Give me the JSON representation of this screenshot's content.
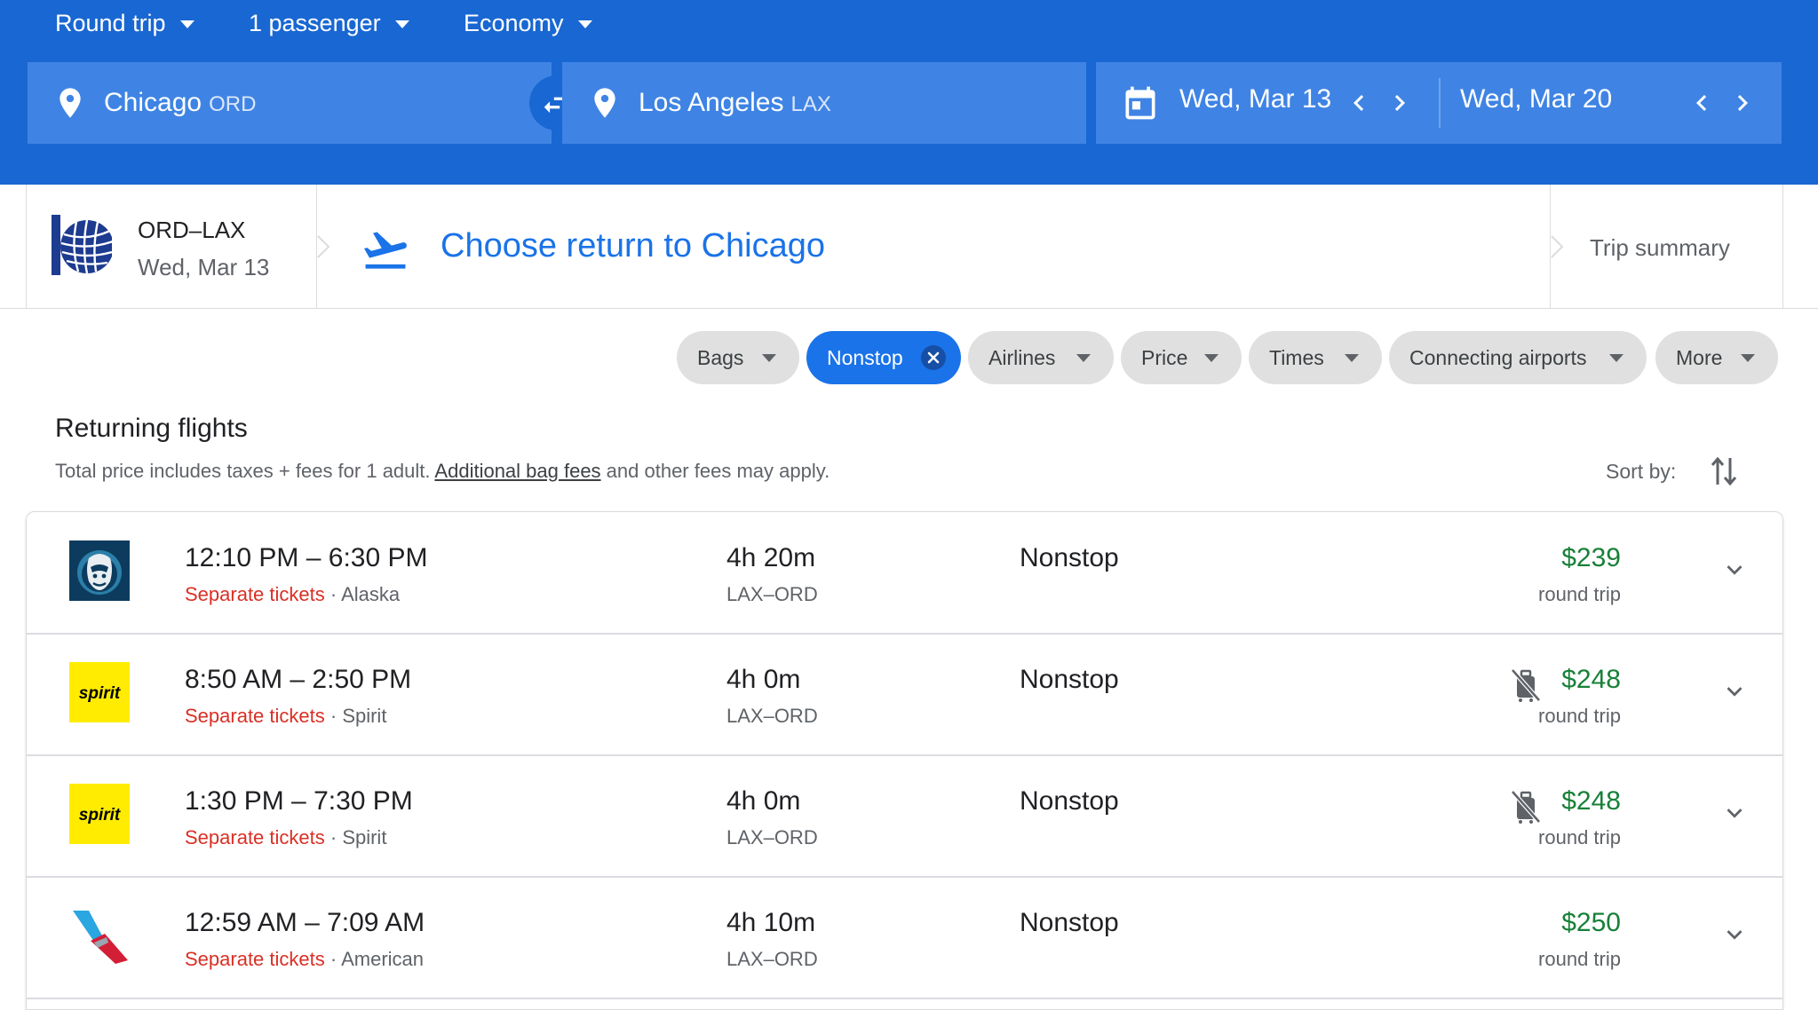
{
  "search": {
    "trip_type": "Round trip",
    "passengers": "1 passenger",
    "cabin": "Economy",
    "origin_city": "Chicago",
    "origin_code": "ORD",
    "destination_city": "Los Angeles",
    "destination_code": "LAX",
    "depart_date": "Wed, Mar 13",
    "return_date": "Wed, Mar 20"
  },
  "breadcrumb": {
    "leg_route": "ORD–LAX",
    "leg_date": "Wed, Mar 13",
    "step_title": "Choose return to Chicago",
    "trip_summary": "Trip summary"
  },
  "filters": [
    {
      "label": "Bags",
      "active": false
    },
    {
      "label": "Nonstop",
      "active": true
    },
    {
      "label": "Airlines",
      "active": false
    },
    {
      "label": "Price",
      "active": false
    },
    {
      "label": "Times",
      "active": false
    },
    {
      "label": "Connecting airports",
      "active": false
    },
    {
      "label": "More",
      "active": false
    }
  ],
  "results_header": {
    "title": "Returning flights",
    "note_prefix": "Total price includes taxes + fees for 1 adult. ",
    "note_link": "Additional bag fees",
    "note_suffix": " and other fees may apply.",
    "sort_label": "Sort by:"
  },
  "flights": [
    {
      "times": "12:10 PM – 6:30 PM",
      "tickets": "Separate tickets",
      "airline": "Alaska",
      "duration": "4h 20m",
      "route": "LAX–ORD",
      "stops": "Nonstop",
      "price": "$239",
      "price_type": "round trip",
      "logo": "alaska-logo",
      "no_carry_on": false
    },
    {
      "times": "8:50 AM – 2:50 PM",
      "tickets": "Separate tickets",
      "airline": "Spirit",
      "duration": "4h 0m",
      "route": "LAX–ORD",
      "stops": "Nonstop",
      "price": "$248",
      "price_type": "round trip",
      "logo": "spirit-logo",
      "no_carry_on": true
    },
    {
      "times": "1:30 PM – 7:30 PM",
      "tickets": "Separate tickets",
      "airline": "Spirit",
      "duration": "4h 0m",
      "route": "LAX–ORD",
      "stops": "Nonstop",
      "price": "$248",
      "price_type": "round trip",
      "logo": "spirit-logo",
      "no_carry_on": true
    },
    {
      "times": "12:59 AM – 7:09 AM",
      "tickets": "Separate tickets",
      "airline": "American",
      "duration": "4h 10m",
      "route": "LAX–ORD",
      "stops": "Nonstop",
      "price": "$250",
      "price_type": "round trip",
      "logo": "american-logo",
      "no_carry_on": false
    }
  ],
  "logo_text": {
    "spirit": "spirit"
  },
  "colors": {
    "header_blue": "#1967d2",
    "field_blue": "#3f84e4",
    "accent_blue": "#1a73e8",
    "price_green": "#188038",
    "warning_red": "#d93025",
    "spirit_yellow": "#ffec00"
  }
}
